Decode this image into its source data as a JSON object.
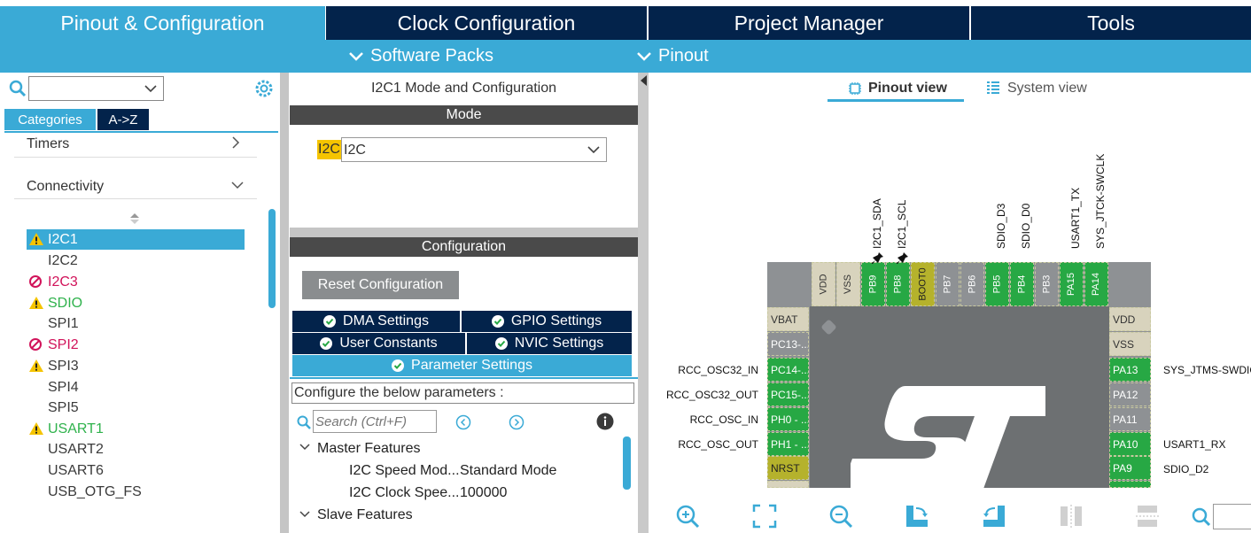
{
  "top_tabs": [
    {
      "label": "Pinout & Configuration",
      "active": true
    },
    {
      "label": "Clock Configuration",
      "active": false
    },
    {
      "label": "Project Manager",
      "active": false
    },
    {
      "label": "Tools",
      "active": false
    }
  ],
  "sub_menu": {
    "software_packs": "Software Packs",
    "pinout": "Pinout"
  },
  "left": {
    "search": {
      "value": ""
    },
    "tabs": {
      "categories": "Categories",
      "az": "A->Z"
    },
    "categories": {
      "timers": "Timers",
      "connectivity": "Connectivity"
    },
    "peripherals": [
      {
        "label": "I2C1",
        "status": "warning",
        "selected": true
      },
      {
        "label": "I2C2",
        "status": "none"
      },
      {
        "label": "I2C3",
        "status": "blocked"
      },
      {
        "label": "SDIO",
        "status": "warning"
      },
      {
        "label": "SPI1",
        "status": "none"
      },
      {
        "label": "SPI2",
        "status": "blocked"
      },
      {
        "label": "SPI3",
        "status": "warning"
      },
      {
        "label": "SPI4",
        "status": "none"
      },
      {
        "label": "SPI5",
        "status": "none"
      },
      {
        "label": "USART1",
        "status": "warning"
      },
      {
        "label": "USART2",
        "status": "none"
      },
      {
        "label": "USART6",
        "status": "none"
      },
      {
        "label": "USB_OTG_FS",
        "status": "none"
      }
    ]
  },
  "middle": {
    "title": "I2C1 Mode and Configuration",
    "mode_header": "Mode",
    "mode_label": "I2C",
    "mode_select_value": "I2C",
    "config_header": "Configuration",
    "reset_button": "Reset Configuration",
    "settings_tabs": {
      "dma": "DMA Settings",
      "gpio": "GPIO Settings",
      "user": "User Constants",
      "nvic": "NVIC Settings",
      "param": "Parameter Settings"
    },
    "configure_text": "Configure the below parameters :",
    "search_placeholder": "Search (Ctrl+F)",
    "tree": {
      "master": "Master Features",
      "speed_name": "I2C Speed Mod...",
      "speed_value": "Standard Mode",
      "clock_name": "I2C Clock Spee...",
      "clock_value": "100000",
      "slave": "Slave Features"
    }
  },
  "right": {
    "view_tabs": {
      "pinout": "Pinout view",
      "system": "System view"
    },
    "top_signal_labels": [
      "I2C1_SDA",
      "I2C1_SCL",
      "SDIO_D3",
      "SDIO_D0",
      "USART1_TX",
      "SYS_JTCK-SWCLK"
    ],
    "top_pins": [
      "VDD",
      "VSS",
      "PB9",
      "PB8",
      "BOOT0",
      "PB7",
      "PB6",
      "PB5",
      "PB4",
      "PB3",
      "PA15",
      "PA14"
    ],
    "left_pins": [
      "VBAT",
      "PC13-...",
      "PC14-...",
      "PC15-...",
      "PH0 - ...",
      "PH1 - ...",
      "NRST"
    ],
    "left_signals": [
      "RCC_OSC32_IN",
      "RCC_OSC32_OUT",
      "RCC_OSC_IN",
      "RCC_OSC_OUT"
    ],
    "right_pins": [
      "VDD",
      "VSS",
      "PA13",
      "PA12",
      "PA11",
      "PA10",
      "PA9"
    ],
    "right_signals": [
      "SYS_JTMS-SWDIO",
      "USART1_RX",
      "SDIO_D2"
    ]
  },
  "colors": {
    "accent": "#3aaad6",
    "navy": "#03234b",
    "pin_green": "#27a844",
    "warning": "#f5c400",
    "blocked": "#d1135a"
  }
}
